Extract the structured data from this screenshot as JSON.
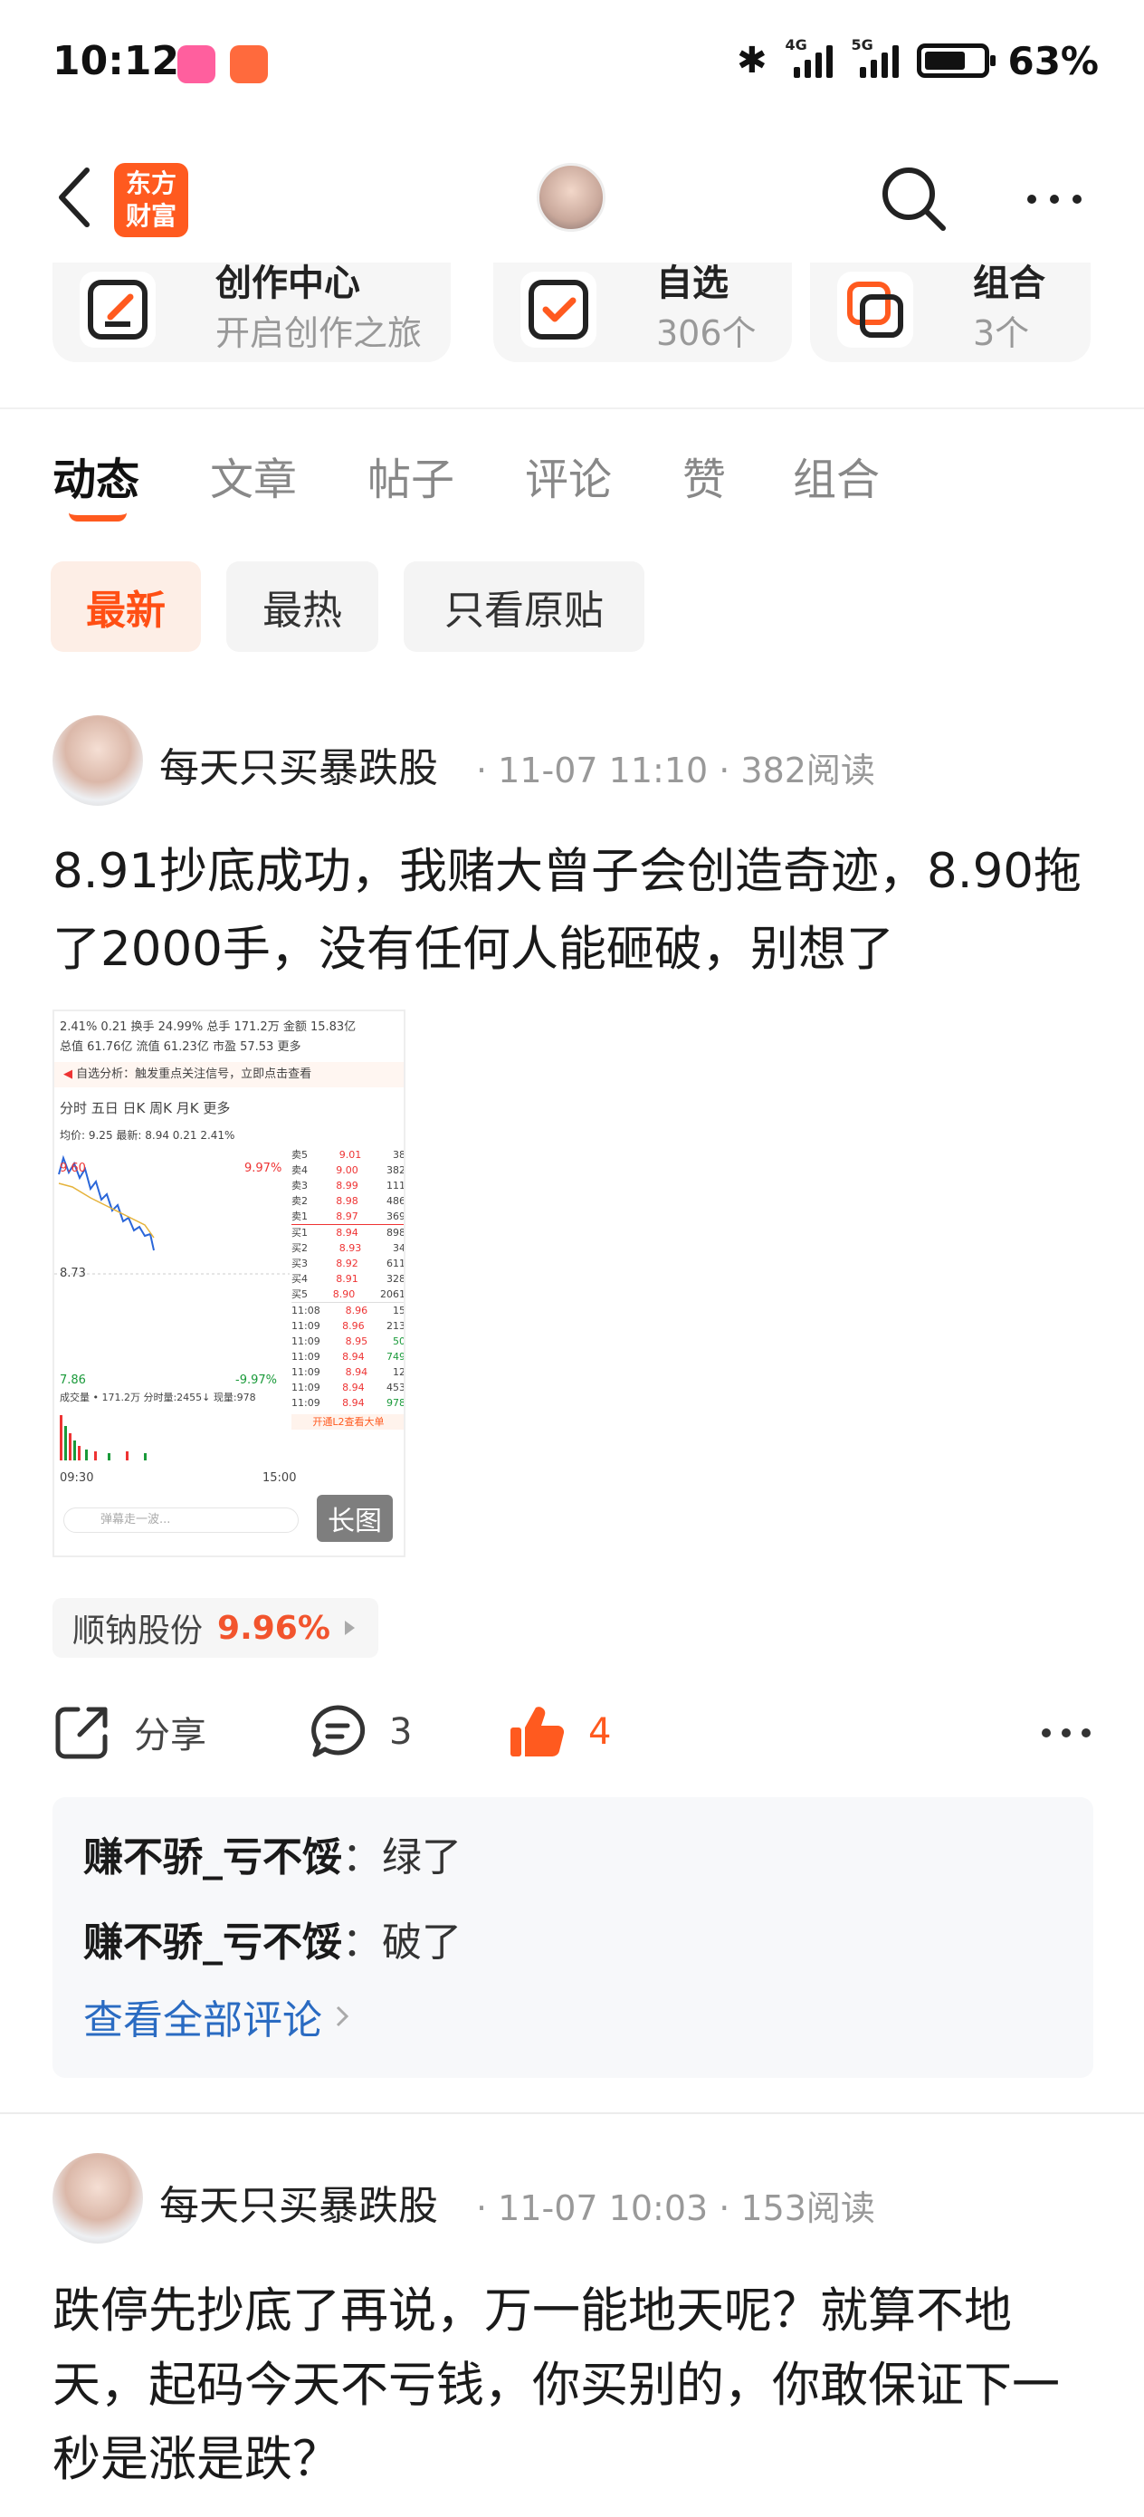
{
  "status_bar": {
    "time": "10:12",
    "battery": "63%",
    "network_1": "4G",
    "network_2": "5G",
    "icons": [
      "bilibili-app-icon",
      "notification-app-icon",
      "bluetooth-icon",
      "signal-icon",
      "battery-icon"
    ]
  },
  "nav": {
    "logo_line1": "东方",
    "logo_line2": "财富",
    "icons": [
      "back-icon",
      "search-icon",
      "more-icon"
    ]
  },
  "quick_cards": [
    {
      "title": "创作中心",
      "subtitle": "开启创作之旅",
      "icon": "edit-icon"
    },
    {
      "title": "自选",
      "subtitle": "306个",
      "icon": "checkbox-icon"
    },
    {
      "title": "组合",
      "subtitle": "3个",
      "icon": "portfolio-icon"
    }
  ],
  "tabs": [
    "动态",
    "文章",
    "帖子",
    "评论",
    "赞",
    "组合"
  ],
  "active_tab": "动态",
  "filters": [
    "最新",
    "最热",
    "只看原贴"
  ],
  "active_filter": "最新",
  "posts": [
    {
      "author": "每天只买暴跌股",
      "meta": "· 11-07 11:10 · 382阅读",
      "text": "8.91抄底成功，我赌大曾子会创造奇迹，8.90拖了2000手，没有任何人能砸破，别想了",
      "image_label": "长图",
      "image": {
        "header_row1": "2.41%  0.21  换手 24.99%  总手 171.2万  金额 15.83亿",
        "header_row2": "总值 61.76亿  流值 61.23亿  市盈 57.53  更多",
        "notice": "自选分析：触发重点关注信号，立即点击查看",
        "periods": "分时  五日  日K  周K  月K  更多",
        "price_line": "均价: 9.25  最新: 8.94  0.21  2.41%",
        "high": "9.60",
        "high_pct": "9.97%",
        "mid": "8.73",
        "low": "7.86",
        "low_pct": "-9.97%",
        "volume": "成交量 • 171.2万  分时量:2455↓  现量:978",
        "time_start": "09:30",
        "time_end": "15:00",
        "ask": [
          [
            "卖5",
            "9.01",
            "38"
          ],
          [
            "卖4",
            "9.00",
            "382"
          ],
          [
            "卖3",
            "8.99",
            "111"
          ],
          [
            "卖2",
            "8.98",
            "486"
          ],
          [
            "卖1",
            "8.97",
            "369"
          ]
        ],
        "bid": [
          [
            "买1",
            "8.94",
            "898"
          ],
          [
            "买2",
            "8.93",
            "34"
          ],
          [
            "买3",
            "8.92",
            "611"
          ],
          [
            "买4",
            "8.91",
            "328"
          ],
          [
            "买5",
            "8.90",
            "2061"
          ]
        ],
        "trades": [
          [
            "11:08",
            "8.96",
            "15"
          ],
          [
            "11:09",
            "8.96",
            "213"
          ],
          [
            "11:09",
            "8.95",
            "50"
          ],
          [
            "11:09",
            "8.94",
            "749"
          ],
          [
            "11:09",
            "8.94",
            "12"
          ],
          [
            "11:09",
            "8.94",
            "453"
          ],
          [
            "11:09",
            "8.94",
            "978"
          ]
        ],
        "level2": "开通L2查看大单",
        "comment_placeholder": "弹幕走一波..."
      },
      "stock_tag": {
        "name": "顺钠股份",
        "change": "9.96%"
      },
      "actions": {
        "share": "分享",
        "comments": "3",
        "likes": "4"
      },
      "comments": [
        {
          "user": "赚不骄_亏不馁",
          "text": "绿了"
        },
        {
          "user": "赚不骄_亏不馁",
          "text": "破了"
        }
      ],
      "view_all": "查看全部评论"
    },
    {
      "author": "每天只买暴跌股",
      "meta": "· 11-07 10:03 · 153阅读",
      "text": "跌停先抄底了再说，万一能地天呢？就算不地天，起码今天不亏钱，你买别的，你敢保证下一秒是涨是跌？"
    }
  ]
}
